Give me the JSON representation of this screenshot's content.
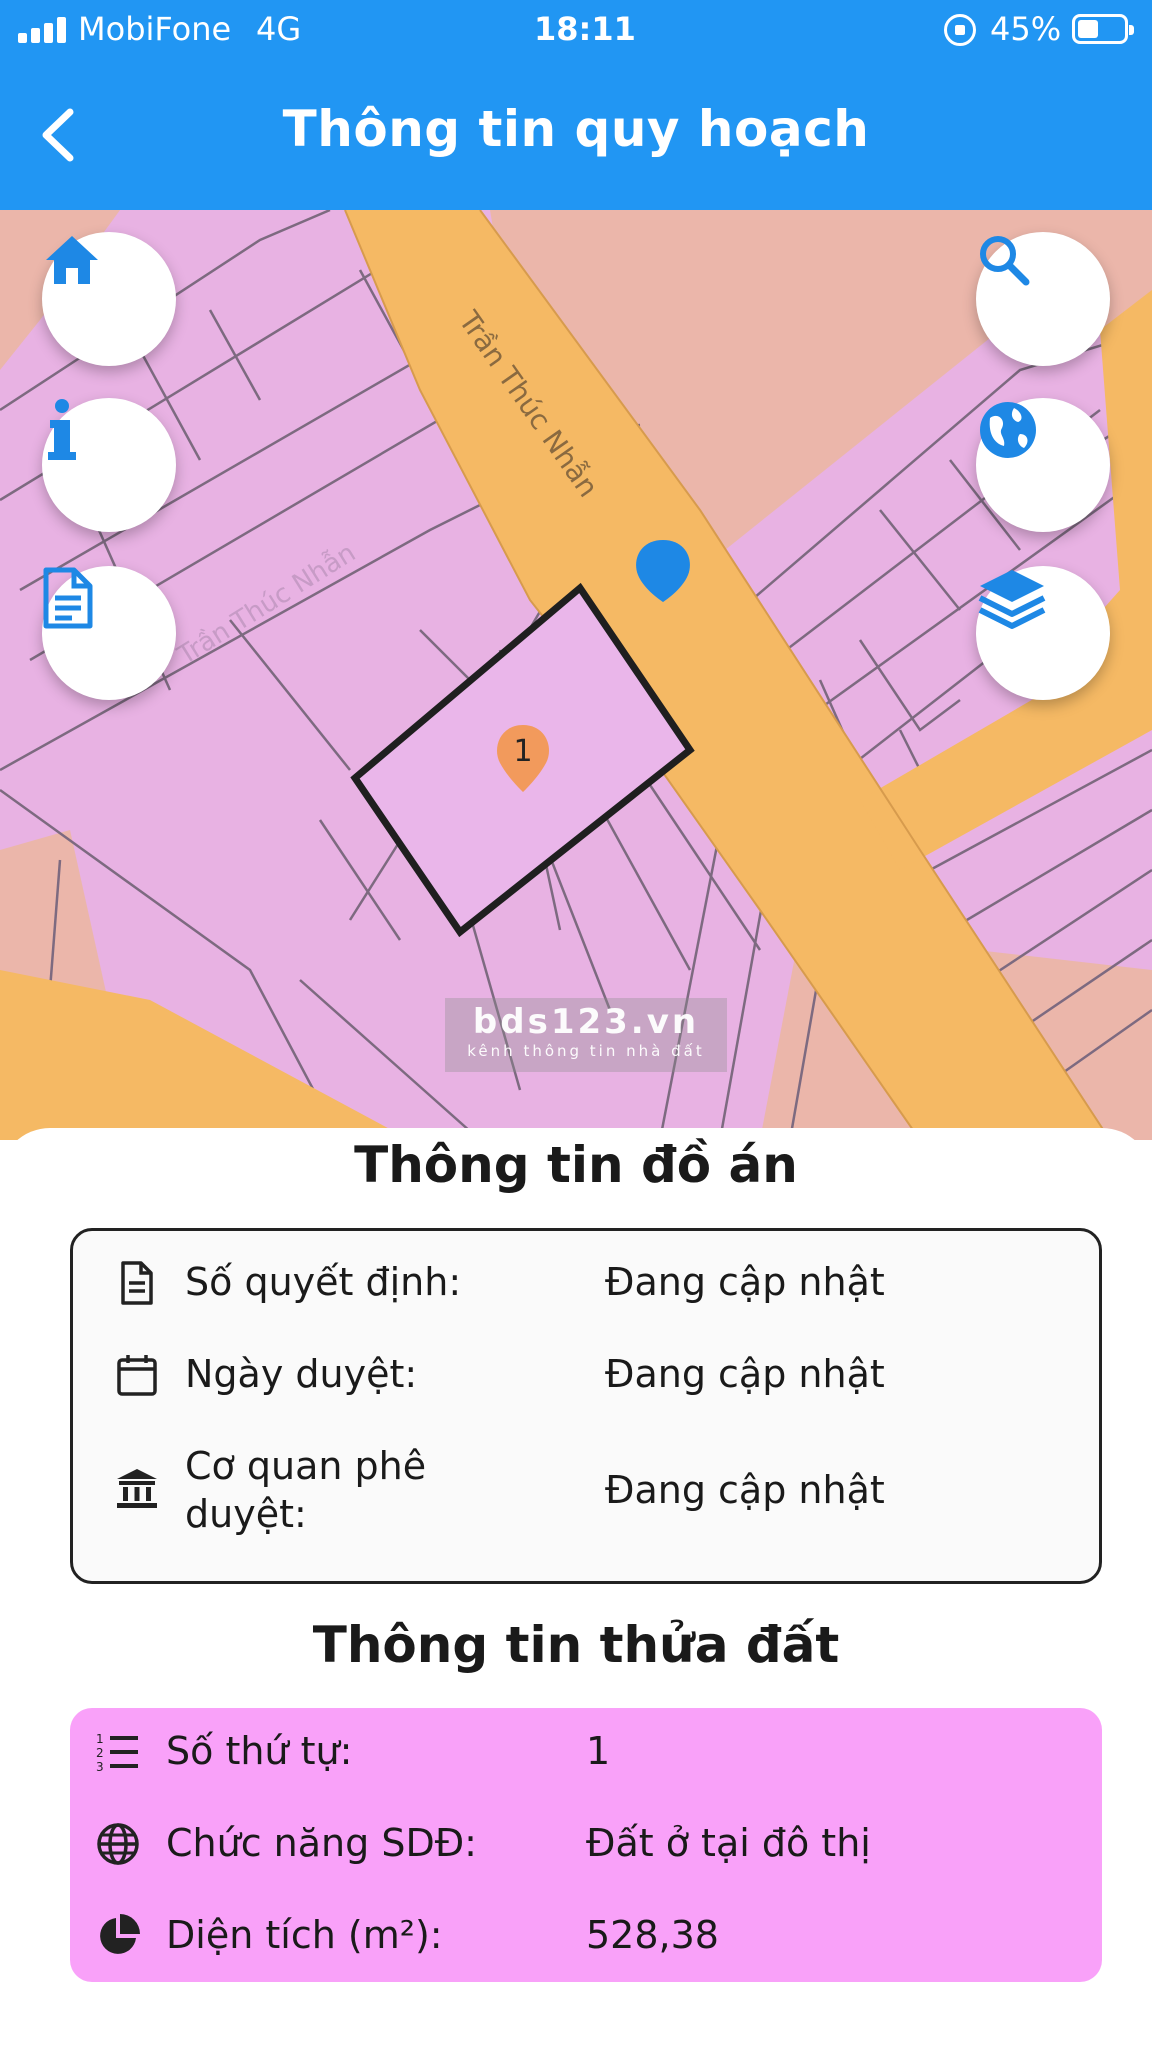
{
  "status": {
    "carrier": "MobiFone",
    "network": "4G",
    "time": "18:11",
    "battery": "45%"
  },
  "header": {
    "title": "Thông tin quy hoạch"
  },
  "map": {
    "street_name": "Trần Thúc Nhẫn",
    "street_name_faded": "Trần Thúc Nhẫn",
    "parcel_marker": "1",
    "watermark_name": "bds123.vn",
    "watermark_sub": "kênh thông tin nhà đất",
    "colors": {
      "residential": "#e8b2e3",
      "road": "#f5b964",
      "public": "#ebb6aa",
      "marker_blue": "#1e88e5",
      "marker_orange": "#f29a5c"
    }
  },
  "plan_info": {
    "title": "Thông tin đồ án",
    "rows": [
      {
        "icon": "document-icon",
        "label": "Số quyết định:",
        "value": "Đang cập nhật"
      },
      {
        "icon": "calendar-icon",
        "label": "Ngày duyệt:",
        "value": "Đang cập nhật"
      },
      {
        "icon": "bank-icon",
        "label_line1": "Cơ quan phê",
        "label_line2": "duyệt:",
        "value": "Đang cập nhật"
      }
    ]
  },
  "parcel_info": {
    "title": "Thông tin thửa đất",
    "background": "#f9a1f9",
    "rows": [
      {
        "icon": "numbered-list-icon",
        "label": "Số thứ tự:",
        "value": "1"
      },
      {
        "icon": "globe-icon",
        "label": "Chức năng SDĐ:",
        "value": "Đất ở tại đô thị"
      },
      {
        "icon": "pie-chart-icon",
        "label": "Diện tích (m²):",
        "value": "528,38"
      }
    ]
  }
}
